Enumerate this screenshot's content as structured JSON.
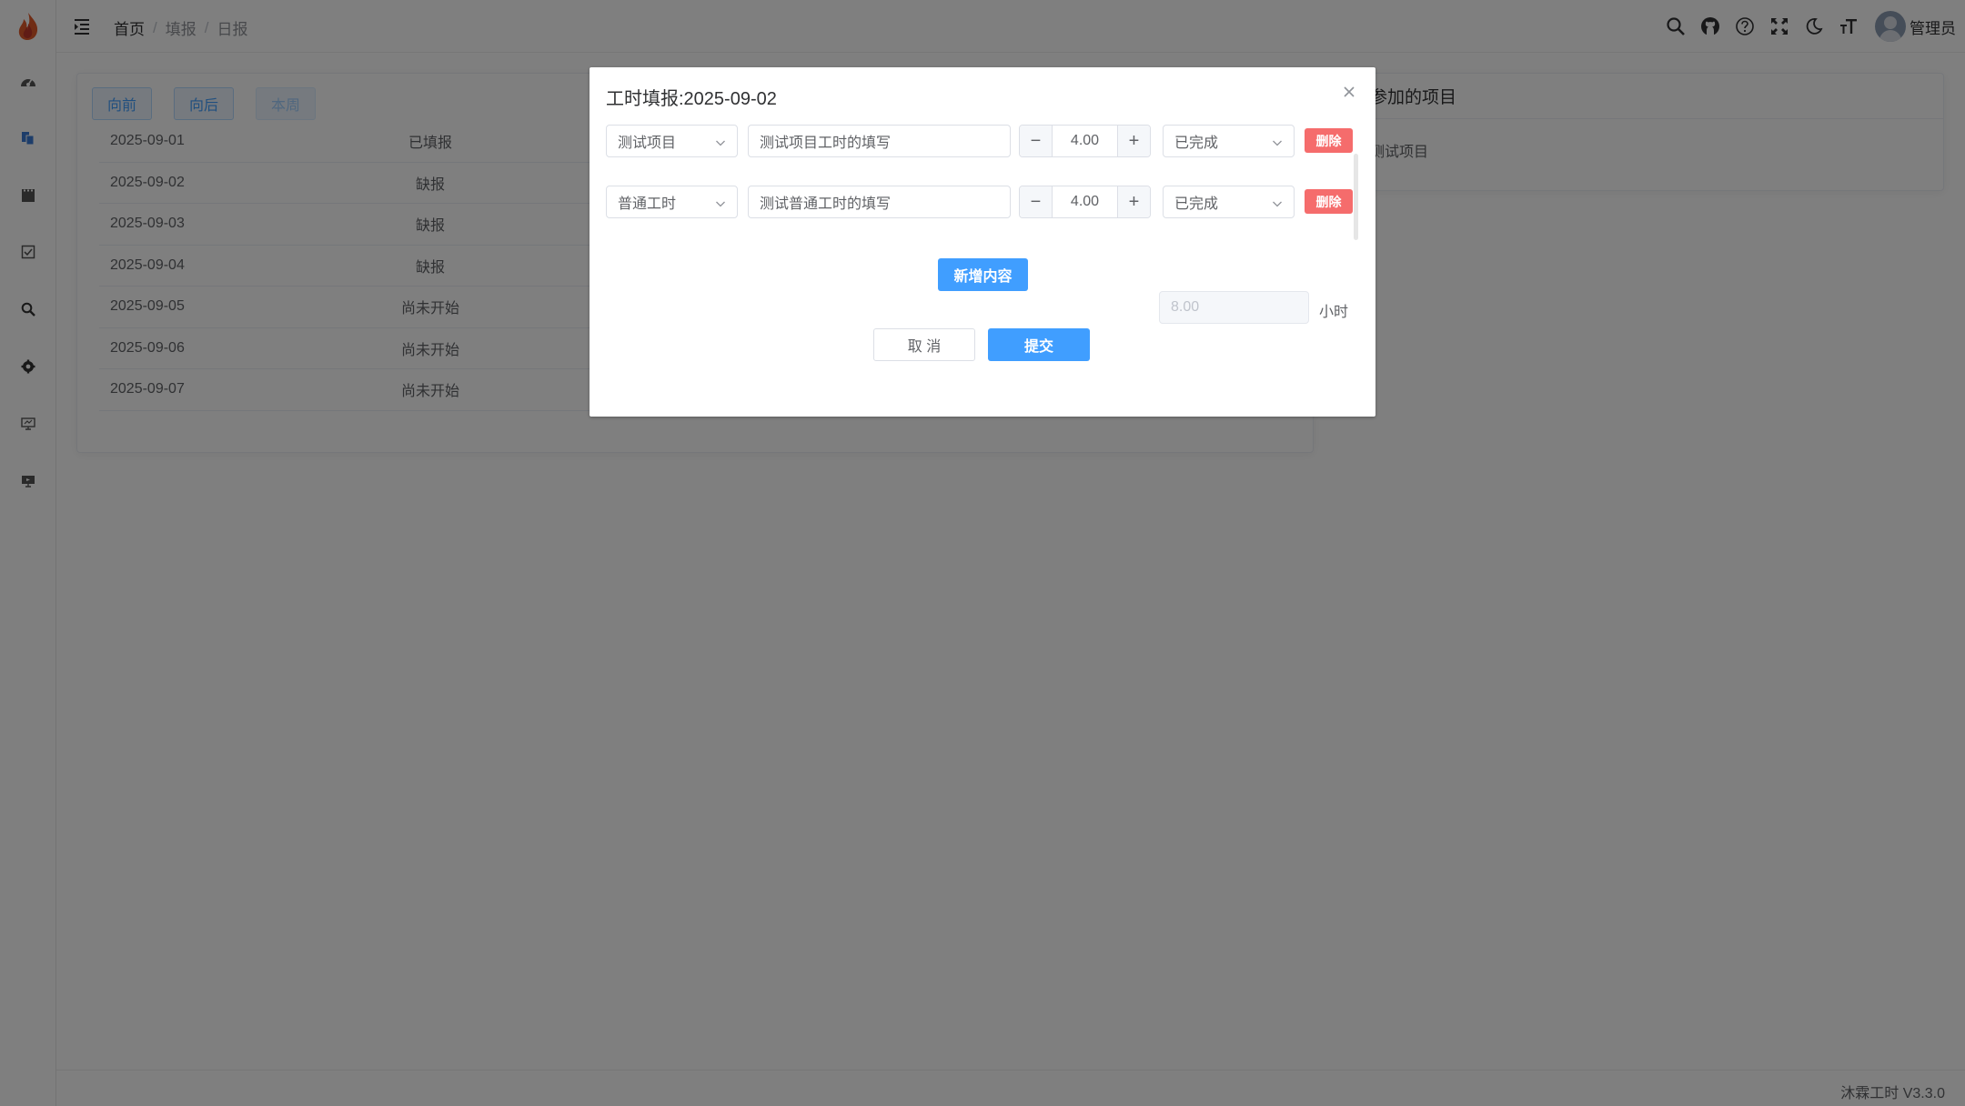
{
  "header": {
    "breadcrumb": [
      "首页",
      "填报",
      "日报"
    ],
    "username": "管理员"
  },
  "toolbar": {
    "prev_label": "向前",
    "next_label": "向后",
    "this_week_label": "本周"
  },
  "days": [
    {
      "date": "2025-09-01",
      "status": "已填报"
    },
    {
      "date": "2025-09-02",
      "status": "缺报"
    },
    {
      "date": "2025-09-03",
      "status": "缺报"
    },
    {
      "date": "2025-09-04",
      "status": "缺报"
    },
    {
      "date": "2025-09-05",
      "status": "尚未开始"
    },
    {
      "date": "2025-09-06",
      "status": "尚未开始"
    },
    {
      "date": "2025-09-07",
      "status": "尚未开始"
    }
  ],
  "projects_card": {
    "title": "参加的项目",
    "item": "测试项目"
  },
  "footer": {
    "version": "沐霖工时 V3.3.0"
  },
  "dialog": {
    "title": "工时填报:2025-09-02",
    "entries": [
      {
        "project": "测试项目",
        "content": "测试项目工时的填写",
        "hours": "4.00",
        "status": "已完成",
        "delete_label": "删除"
      },
      {
        "project": "普通工时",
        "content": "测试普通工时的填写",
        "hours": "4.00",
        "status": "已完成",
        "delete_label": "删除"
      }
    ],
    "add_label": "新增内容",
    "total_hours": "8.00",
    "total_unit": "小时",
    "cancel_label": "取 消",
    "submit_label": "提交"
  },
  "colors": {
    "primary": "#409eff",
    "danger": "#f56c6c",
    "mask": "rgba(0,0,0,0.5)"
  }
}
